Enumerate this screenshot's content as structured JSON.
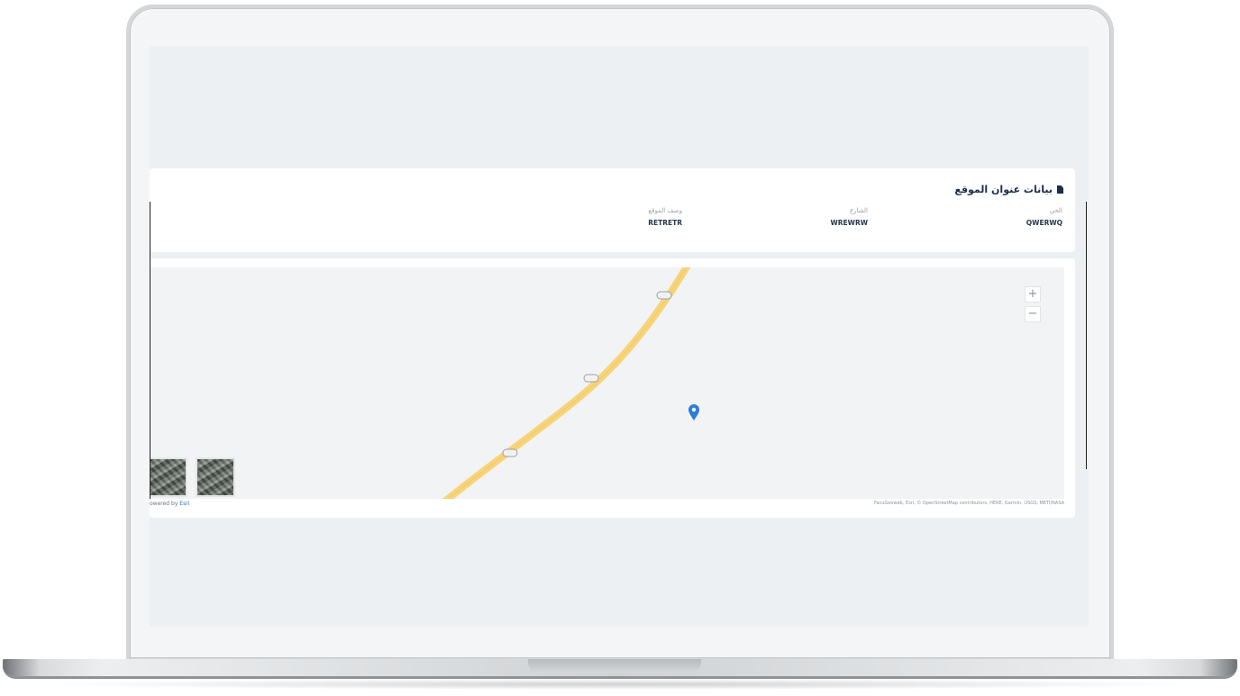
{
  "card": {
    "title": "بيانات عنوان الموقع"
  },
  "fields": [
    {
      "label": "الحي",
      "value": "QWERWQ"
    },
    {
      "label": "الشارع",
      "value": "WREWRW"
    },
    {
      "label": "وصف الموقع",
      "value": "RETRETR"
    }
  ],
  "map": {
    "zoom_in": "+",
    "zoom_out": "−",
    "powered_by": "owered by ",
    "esri": "Esri",
    "attribution": "FacuGeoweb, Esri, © OpenStreetMap contributors, HERE, Garmin, USGS, METI/NASA"
  },
  "colors": {
    "road": "#f6d47a",
    "marker": "#2f7dd6",
    "title_text": "#1b2e4b"
  }
}
